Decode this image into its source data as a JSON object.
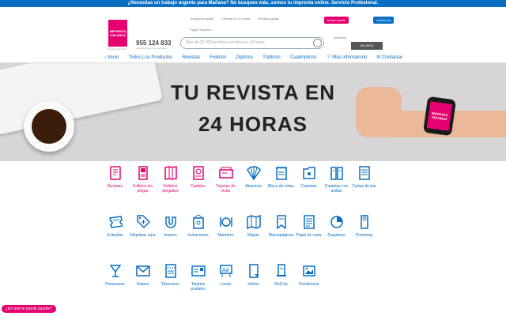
{
  "topbar": {
    "text": "¿Necesitas un trabajo urgente para Mañana? No busques más, somos tu imprenta online. Servicio Profesional."
  },
  "header": {
    "logo_text": "IMPRENTA ONLINE24",
    "logo_sub": "imprenta online 24",
    "features": [
      "Transporte gratis",
      "Entrega en 24 horas",
      "Revisión gratis"
    ],
    "features2": "Pagos Seguros",
    "phone": "955 124 833",
    "phone_sub": "Horario de atención personal",
    "search_placeholder": "Más de 25.000 pedidos servidos en 24 horas",
    "search_hint": "Envíos con entrega gratis en 24 horas · Te damos el transporte · Revisión digital sin coste",
    "login_label": "Iniciar sesión",
    "cart_label": "Carrito (0)",
    "badge_label": "Imprenta",
    "badge_text": "ONLINE24"
  },
  "nav": [
    "⌂ Inicio",
    "Todos Los Productos",
    "Revistas",
    "Folletos",
    "Dípticos",
    "Trípticos",
    "Cuadrípticos",
    "ⓘ Más información",
    "✉ Contactar"
  ],
  "hero": {
    "line1": "TU REVISTA EN",
    "line2": "24 HORAS",
    "watch_text": "IMPRENTA ONLINE24"
  },
  "products": [
    {
      "label": "Revistas",
      "color": "#e6006f",
      "icon": "magazine-icon"
    },
    {
      "label": "Folletos sin plegar",
      "color": "#e6006f",
      "icon": "flyer-icon"
    },
    {
      "label": "Folletos plegados",
      "color": "#e6006f",
      "icon": "folded-flyer-icon"
    },
    {
      "label": "Carteles",
      "color": "#e6006f",
      "icon": "poster-icon"
    },
    {
      "label": "Tarjetas de visita",
      "color": "#e6006f",
      "icon": "business-card-icon"
    },
    {
      "label": "Abanicos",
      "color": "#0a6fc2",
      "icon": "fan-icon"
    },
    {
      "label": "Blocs de notas",
      "color": "#0a6fc2",
      "icon": "notepad-icon"
    },
    {
      "label": "Carpetas",
      "color": "#0a6fc2",
      "icon": "folder-icon"
    },
    {
      "label": "Carpetas con anillas",
      "color": "#0a6fc2",
      "icon": "ring-binder-icon"
    },
    {
      "label": "Cartas de bar",
      "color": "#0a6fc2",
      "icon": "menu-card-icon"
    },
    {
      "label": "",
      "color": "#0a6fc2",
      "icon": ""
    },
    {
      "label": "Entradas",
      "color": "#0a6fc2",
      "icon": "ticket-icon"
    },
    {
      "label": "Etiquetas ropa",
      "color": "#0a6fc2",
      "icon": "clothing-label-icon"
    },
    {
      "label": "Imanes",
      "color": "#0a6fc2",
      "icon": "magnet-icon"
    },
    {
      "label": "Invitaciones",
      "color": "#0a6fc2",
      "icon": "invitation-icon"
    },
    {
      "label": "Manteles",
      "color": "#0a6fc2",
      "icon": "placemat-icon"
    },
    {
      "label": "Mapas",
      "color": "#0a6fc2",
      "icon": "map-icon"
    },
    {
      "label": "Marcapáginas",
      "color": "#0a6fc2",
      "icon": "bookmark-icon"
    },
    {
      "label": "Papel de carta",
      "color": "#0a6fc2",
      "icon": "letter-paper-icon"
    },
    {
      "label": "Pegatinas",
      "color": "#0a6fc2",
      "icon": "sticker-icon"
    },
    {
      "label": "Pomming",
      "color": "#0a6fc2",
      "icon": "door-hanger-icon"
    },
    {
      "label": "",
      "color": "#0a6fc2",
      "icon": ""
    },
    {
      "label": "Posavasos",
      "color": "#0a6fc2",
      "icon": "coaster-icon"
    },
    {
      "label": "Sobres",
      "color": "#0a6fc2",
      "icon": "envelope-icon"
    },
    {
      "label": "Talonarios",
      "color": "#0a6fc2",
      "icon": "receipt-book-icon"
    },
    {
      "label": "Tarjetas postales",
      "color": "#0a6fc2",
      "icon": "postcard-icon"
    },
    {
      "label": "Lonas",
      "color": "#0a6fc2",
      "icon": "banner-icon"
    },
    {
      "label": "Vinilos",
      "color": "#0a6fc2",
      "icon": "vinyl-icon"
    },
    {
      "label": "Roll Up",
      "color": "#0a6fc2",
      "icon": "roll-up-icon"
    },
    {
      "label": "Fotolienzos",
      "color": "#0a6fc2",
      "icon": "canvas-icon"
    }
  ],
  "chat": {
    "label": "¿En que te puedo ayudar?"
  }
}
